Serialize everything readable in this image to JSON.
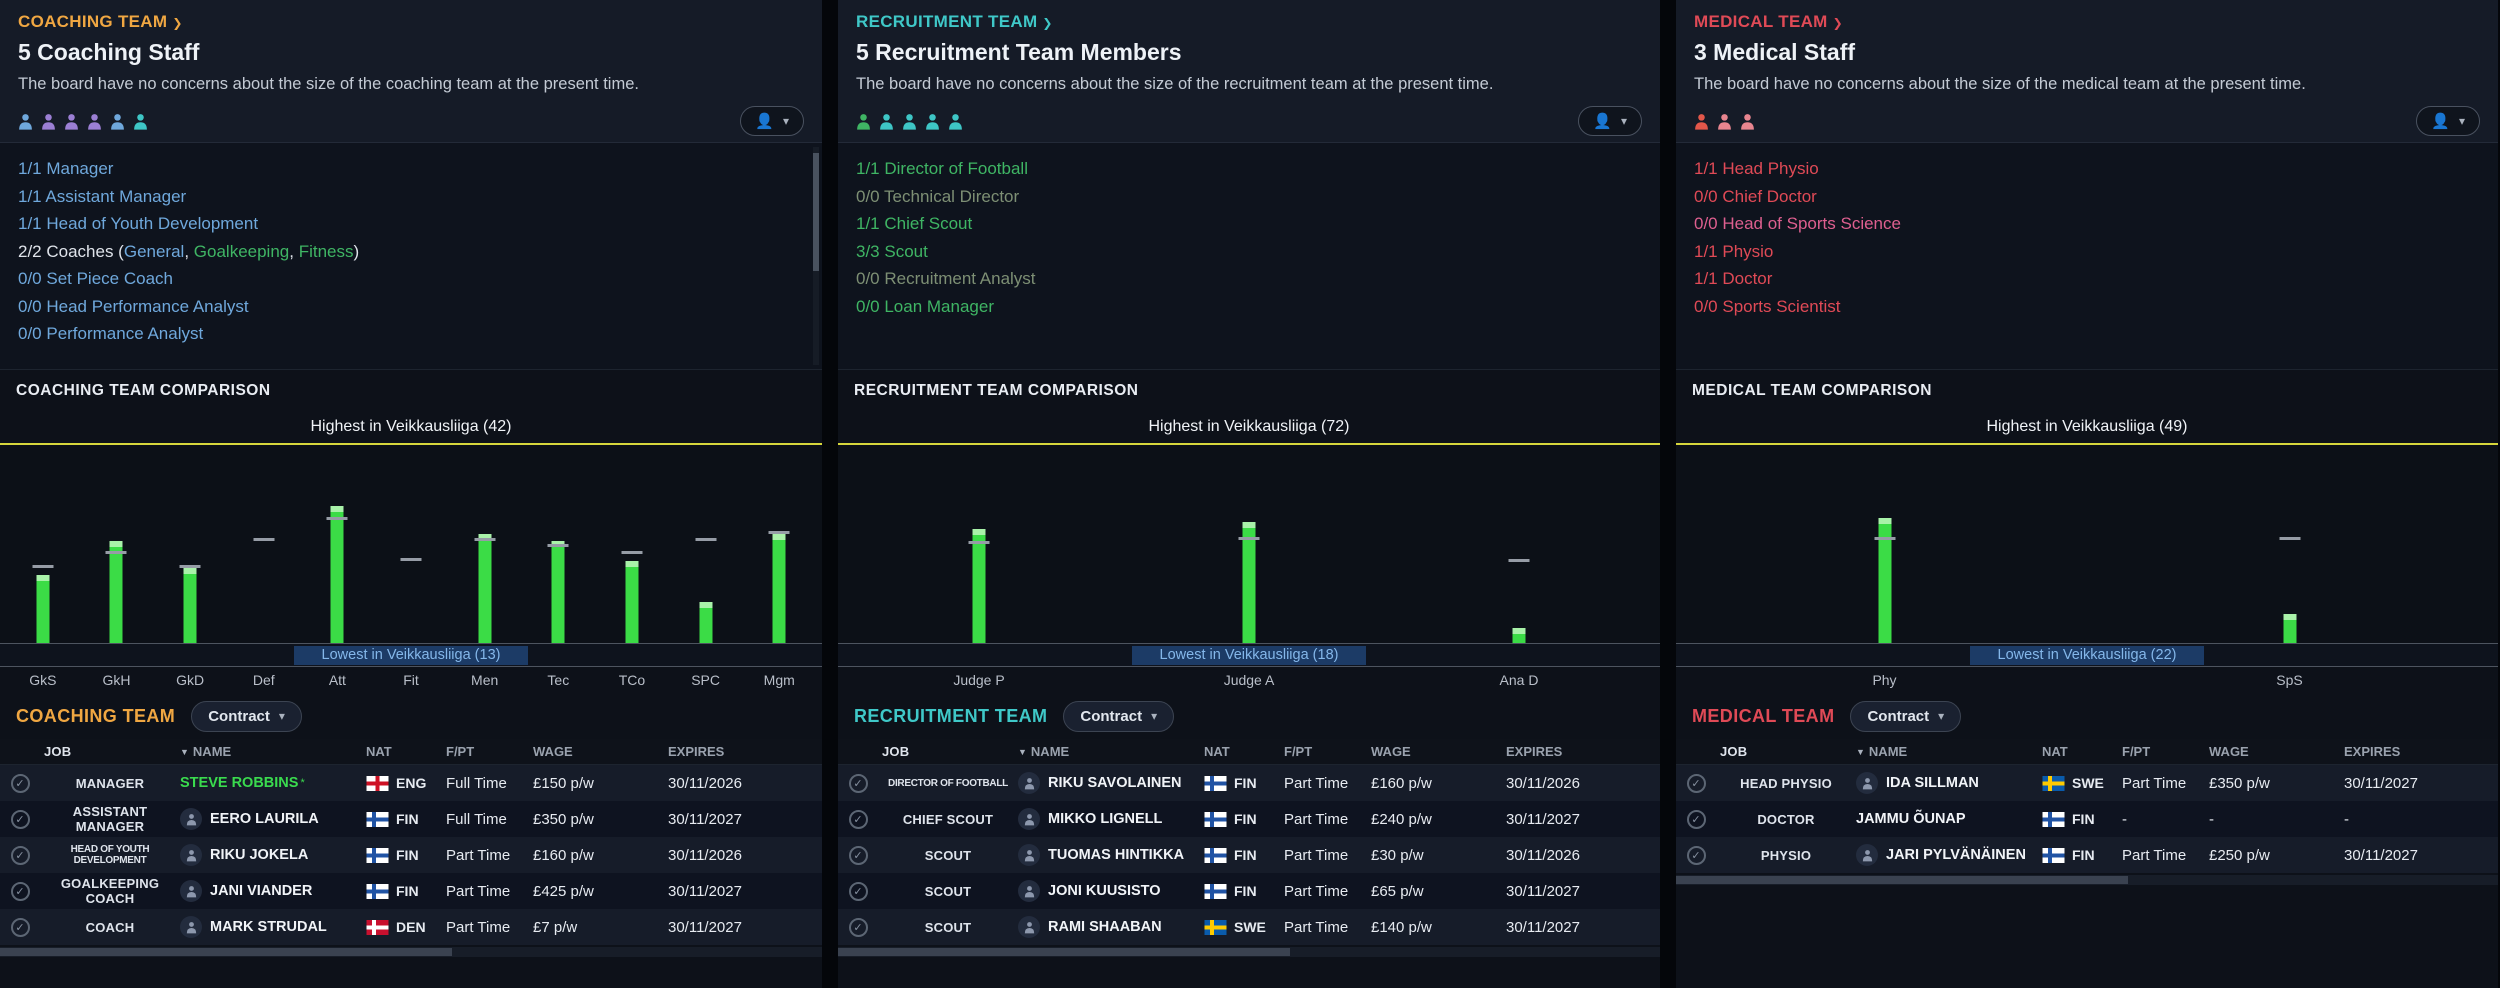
{
  "ui": {
    "arrow_glyph": "❯",
    "chevron_glyph": "▾",
    "sort_glyph": "▼",
    "check_glyph": "✓"
  },
  "colors": {
    "bar": "#3bdc46",
    "bar_tip": "#a9f2a9",
    "avg_dash": "#969ca6",
    "highest_line": "#d6d63c",
    "lowest_bg": "#1c3b66",
    "lowest_text": "#84b7ea"
  },
  "flag_colors": {
    "ENG": {
      "field": "#ffffff",
      "cross": "#ce1124",
      "style": "centered"
    },
    "FIN": {
      "field": "#ffffff",
      "cross": "#2053a4",
      "style": "nordic"
    },
    "DEN": {
      "field": "#c8102e",
      "cross": "#ffffff",
      "style": "nordic"
    },
    "SWE": {
      "field": "#0a5bab",
      "cross": "#fecb00",
      "style": "nordic"
    }
  },
  "panels": [
    {
      "accent": "#f0a742",
      "section_label": "COACHING TEAM",
      "title": "5 Coaching Staff",
      "description": "The board have no concerns about the size of the coaching team at the present time.",
      "staff_icon_colors": [
        "#6fa8dc",
        "#9b7fd4",
        "#9b7fd4",
        "#9b7fd4",
        "#6fa8dc",
        "#3ec6c6"
      ],
      "roles": [
        {
          "parts": [
            {
              "text": "1/1 Manager",
              "color": "#6fa8dc"
            }
          ]
        },
        {
          "parts": [
            {
              "text": "1/1 Assistant Manager",
              "color": "#6fa8dc"
            }
          ]
        },
        {
          "parts": [
            {
              "text": "1/1 Head of Youth Development",
              "color": "#6fa8dc"
            }
          ]
        },
        {
          "parts": [
            {
              "text": "2/2 Coaches (",
              "color": "#dfe3ea"
            },
            {
              "text": "General",
              "color": "#6fa8dc"
            },
            {
              "text": ", ",
              "color": "#dfe3ea"
            },
            {
              "text": "Goalkeeping",
              "color": "#3fb564"
            },
            {
              "text": ", ",
              "color": "#dfe3ea"
            },
            {
              "text": "Fitness",
              "color": "#3fb564"
            },
            {
              "text": ")",
              "color": "#dfe3ea"
            }
          ]
        },
        {
          "parts": [
            {
              "text": "0/0 Set Piece Coach",
              "color": "#6fa8dc"
            }
          ]
        },
        {
          "parts": [
            {
              "text": "0/0 Head Performance Analyst",
              "color": "#6fa8dc"
            }
          ]
        },
        {
          "parts": [
            {
              "text": "0/0 Performance Analyst",
              "color": "#6fa8dc"
            }
          ]
        }
      ],
      "comparison_title": "COACHING TEAM COMPARISON",
      "chart": {
        "type": "bar",
        "highest_label": "Highest in Veikkausliiga (42)",
        "lowest_label": "Lowest in Veikkausliiga (13)",
        "ylim": [
          13,
          42
        ],
        "categories": [
          "GkS",
          "GkH",
          "GkD",
          "Def",
          "Att",
          "Fit",
          "Men",
          "Tec",
          "TCo",
          "SPC",
          "Mgm"
        ],
        "values": [
          23,
          28,
          24,
          13,
          33,
          13,
          29,
          28,
          25,
          19,
          29
        ],
        "league_avg": [
          24,
          26,
          24,
          28,
          31,
          25,
          28,
          27,
          26,
          28,
          29
        ]
      },
      "table_title": "COACHING TEAM",
      "contract_button": "Contract",
      "columns": {
        "job": "JOB",
        "name": "NAME",
        "nat": "NAT",
        "fpt": "F/PT",
        "wage": "WAGE",
        "expires": "EXPIRES"
      },
      "rows": [
        {
          "job": "MANAGER",
          "face": false,
          "name": "STEVE ROBBINS",
          "name_color": "#3adb4e",
          "name_mark": "*",
          "nat": "ENG",
          "fpt": "Full Time",
          "wage": "£150 p/w",
          "expires": "30/11/2026"
        },
        {
          "job": "ASSISTANT MANAGER",
          "face": true,
          "name": "EERO LAURILA",
          "nat": "FIN",
          "fpt": "Full Time",
          "wage": "£350 p/w",
          "expires": "30/11/2027"
        },
        {
          "job": "HEAD OF YOUTH DEVELOPMENT",
          "face": true,
          "name": "RIKU JOKELA",
          "nat": "FIN",
          "fpt": "Part Time",
          "wage": "£160 p/w",
          "expires": "30/11/2026"
        },
        {
          "job": "GOALKEEPING COACH",
          "face": true,
          "name": "JANI VIANDER",
          "nat": "FIN",
          "fpt": "Part Time",
          "wage": "£425 p/w",
          "expires": "30/11/2027"
        },
        {
          "job": "COACH",
          "face": true,
          "name": "MARK STRUDAL",
          "nat": "DEN",
          "fpt": "Part Time",
          "wage": "£7 p/w",
          "expires": "30/11/2027"
        }
      ]
    },
    {
      "accent": "#3fc8c8",
      "section_label": "RECRUITMENT TEAM",
      "title": "5 Recruitment Team Members",
      "description": "The board have no concerns about the size of the recruitment team at the present time.",
      "staff_icon_colors": [
        "#3fb564",
        "#3ec6c6",
        "#3ec6c6",
        "#3ec6c6",
        "#3ec6c6"
      ],
      "roles": [
        {
          "parts": [
            {
              "text": "1/1 Director of Football",
              "color": "#3fb564"
            }
          ]
        },
        {
          "parts": [
            {
              "text": "0/0 Technical Director",
              "color": "#7d8f74"
            }
          ]
        },
        {
          "parts": [
            {
              "text": "1/1 Chief Scout",
              "color": "#3fb564"
            }
          ]
        },
        {
          "parts": [
            {
              "text": "3/3 Scout",
              "color": "#3fb564"
            }
          ]
        },
        {
          "parts": [
            {
              "text": "0/0 Recruitment Analyst",
              "color": "#7d8f74"
            }
          ]
        },
        {
          "parts": [
            {
              "text": "0/0 Loan Manager",
              "color": "#3fb564"
            }
          ]
        }
      ],
      "comparison_title": "RECRUITMENT TEAM COMPARISON",
      "chart": {
        "type": "bar",
        "highest_label": "Highest in Veikkausliiga (72)",
        "lowest_label": "Lowest in Veikkausliiga (18)",
        "ylim": [
          18,
          72
        ],
        "categories": [
          "Judge P",
          "Judge A",
          "Ana D"
        ],
        "values": [
          49,
          51,
          22
        ],
        "league_avg": [
          45,
          46,
          40
        ]
      },
      "table_title": "RECRUITMENT TEAM",
      "contract_button": "Contract",
      "columns": {
        "job": "JOB",
        "name": "NAME",
        "nat": "NAT",
        "fpt": "F/PT",
        "wage": "WAGE",
        "expires": "EXPIRES"
      },
      "rows": [
        {
          "job": "DIRECTOR OF FOOTBALL",
          "face": true,
          "name": "RIKU SAVOLAINEN",
          "nat": "FIN",
          "fpt": "Part Time",
          "wage": "£160 p/w",
          "expires": "30/11/2026"
        },
        {
          "job": "CHIEF SCOUT",
          "face": true,
          "name": "MIKKO LIGNELL",
          "nat": "FIN",
          "fpt": "Part Time",
          "wage": "£240 p/w",
          "expires": "30/11/2027"
        },
        {
          "job": "SCOUT",
          "face": true,
          "name": "TUOMAS HINTIKKA",
          "nat": "FIN",
          "fpt": "Part Time",
          "wage": "£30 p/w",
          "expires": "30/11/2026"
        },
        {
          "job": "SCOUT",
          "face": true,
          "name": "JONI KUUSISTO",
          "nat": "FIN",
          "fpt": "Part Time",
          "wage": "£65 p/w",
          "expires": "30/11/2027"
        },
        {
          "job": "SCOUT",
          "face": true,
          "name": "RAMI SHAABAN",
          "nat": "SWE",
          "fpt": "Part Time",
          "wage": "£140 p/w",
          "expires": "30/11/2027"
        }
      ]
    },
    {
      "accent": "#e04a56",
      "section_label": "MEDICAL TEAM",
      "title": "3 Medical Staff",
      "description": "The board have no concerns about the size of the medical team at the present time.",
      "staff_icon_colors": [
        "#e2574a",
        "#e8858f",
        "#e8858f"
      ],
      "roles": [
        {
          "parts": [
            {
              "text": "1/1 Head Physio",
              "color": "#e04a56"
            }
          ]
        },
        {
          "parts": [
            {
              "text": "0/0 Chief Doctor",
              "color": "#e04a56"
            }
          ]
        },
        {
          "parts": [
            {
              "text": "0/0 Head of Sports Science",
              "color": "#de5f8f"
            }
          ]
        },
        {
          "parts": [
            {
              "text": "1/1 Physio",
              "color": "#e04a56"
            }
          ]
        },
        {
          "parts": [
            {
              "text": "1/1 Doctor",
              "color": "#e04a56"
            }
          ]
        },
        {
          "parts": [
            {
              "text": "0/0 Sports Scientist",
              "color": "#e04a56"
            }
          ]
        }
      ],
      "comparison_title": "MEDICAL TEAM COMPARISON",
      "chart": {
        "type": "bar",
        "highest_label": "Highest in Veikkausliiga (49)",
        "lowest_label": "Lowest in Veikkausliiga (22)",
        "ylim": [
          22,
          49
        ],
        "categories": [
          "Phy",
          "SpS"
        ],
        "values": [
          39,
          26
        ],
        "league_avg": [
          36,
          36
        ]
      },
      "table_title": "MEDICAL TEAM",
      "contract_button": "Contract",
      "columns": {
        "job": "JOB",
        "name": "NAME",
        "nat": "NAT",
        "fpt": "F/PT",
        "wage": "WAGE",
        "expires": "EXPIRES"
      },
      "rows": [
        {
          "job": "HEAD PHYSIO",
          "face": true,
          "name": "IDA SILLMAN",
          "nat": "SWE",
          "fpt": "Part Time",
          "wage": "£350 p/w",
          "expires": "30/11/2027"
        },
        {
          "job": "DOCTOR",
          "face": false,
          "name": "JAMMU ÕUNAP",
          "nat": "FIN",
          "fpt": "-",
          "wage": "-",
          "expires": "-"
        },
        {
          "job": "PHYSIO",
          "face": true,
          "name": "JARI PYLVÄNÄINEN",
          "nat": "FIN",
          "fpt": "Part Time",
          "wage": "£250 p/w",
          "expires": "30/11/2027"
        }
      ]
    }
  ]
}
